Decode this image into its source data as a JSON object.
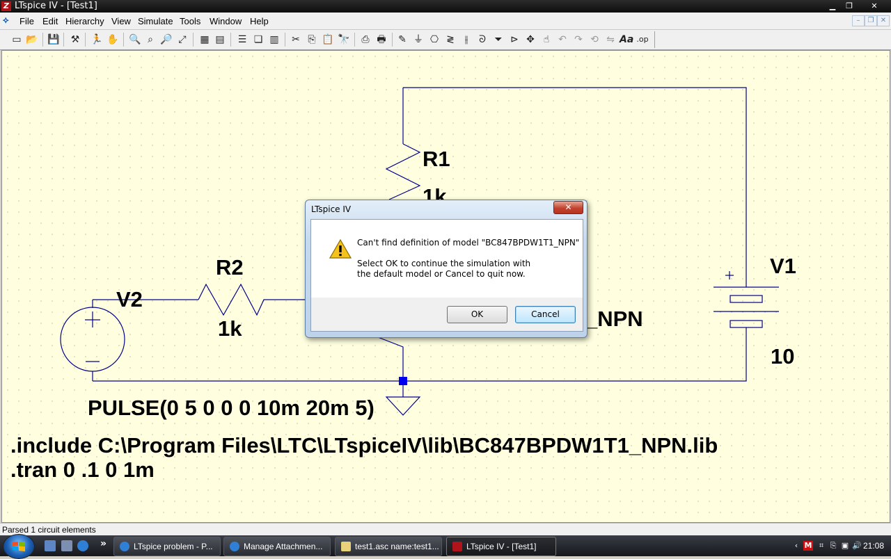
{
  "window": {
    "title": "LTspice IV - [Test1]",
    "app_icon": "ltspice-logo",
    "controls": [
      "minimize",
      "restore",
      "close"
    ]
  },
  "menubar": {
    "items": [
      "File",
      "Edit",
      "Hierarchy",
      "View",
      "Simulate",
      "Tools",
      "Window",
      "Help"
    ]
  },
  "toolbar": {
    "buttons": [
      "new-schematic",
      "open",
      "save",
      "control-panel",
      "run",
      "halt",
      "zoom-in",
      "pan",
      "zoom-out",
      "zoom-fit",
      "autoscale",
      "delete-all",
      "tile-horizontal",
      "cascade",
      "tile-vertical",
      "cut",
      "copy",
      "paste",
      "find",
      "print-setup",
      "print",
      "draw-wire",
      "ground",
      "label-net",
      "resistor",
      "capacitor",
      "inductor",
      "diode",
      "component",
      "move",
      "drag",
      "undo",
      "redo",
      "rotate",
      "mirror",
      "text",
      "spice-directive"
    ]
  },
  "schematic": {
    "components": {
      "r1": {
        "name": "R1",
        "value": "1k"
      },
      "r2": {
        "name": "R2",
        "value": "1k"
      },
      "v1": {
        "name": "V1",
        "value": "10"
      },
      "v2": {
        "name": "V2",
        "value": "PULSE(0 5 0 0 0 10m 20m 5)"
      },
      "q_model_visible": "_NPN"
    },
    "directives": {
      "include": ".include C:\\Program Files\\LTC\\LTspiceIV\\lib\\BC847BPDW1T1_NPN.lib",
      "tran": ".tran 0 .1 0 1m"
    }
  },
  "status": {
    "text": "Parsed 1 circuit elements"
  },
  "dialog": {
    "title": "LTspice IV",
    "close_glyph": "✕",
    "message": "Can't find definition of model \"BC847BPDW1T1_NPN\"",
    "detail_line1": "Select OK to continue the simulation with",
    "detail_line2": "the default model or Cancel to quit now.",
    "ok_label": "OK",
    "cancel_label": "Cancel",
    "icon": "warning-icon"
  },
  "taskbar": {
    "tasks": [
      {
        "label": "LTspice problem - P...",
        "icon": "internet-explorer-icon"
      },
      {
        "label": "Manage Attachmen...",
        "icon": "internet-explorer-icon"
      },
      {
        "label": "test1.asc name:test1...",
        "icon": "notepad-icon"
      },
      {
        "label": "LTspice IV - [Test1]",
        "icon": "ltspice-icon"
      }
    ],
    "clock": "21:08",
    "overflow": "»"
  }
}
